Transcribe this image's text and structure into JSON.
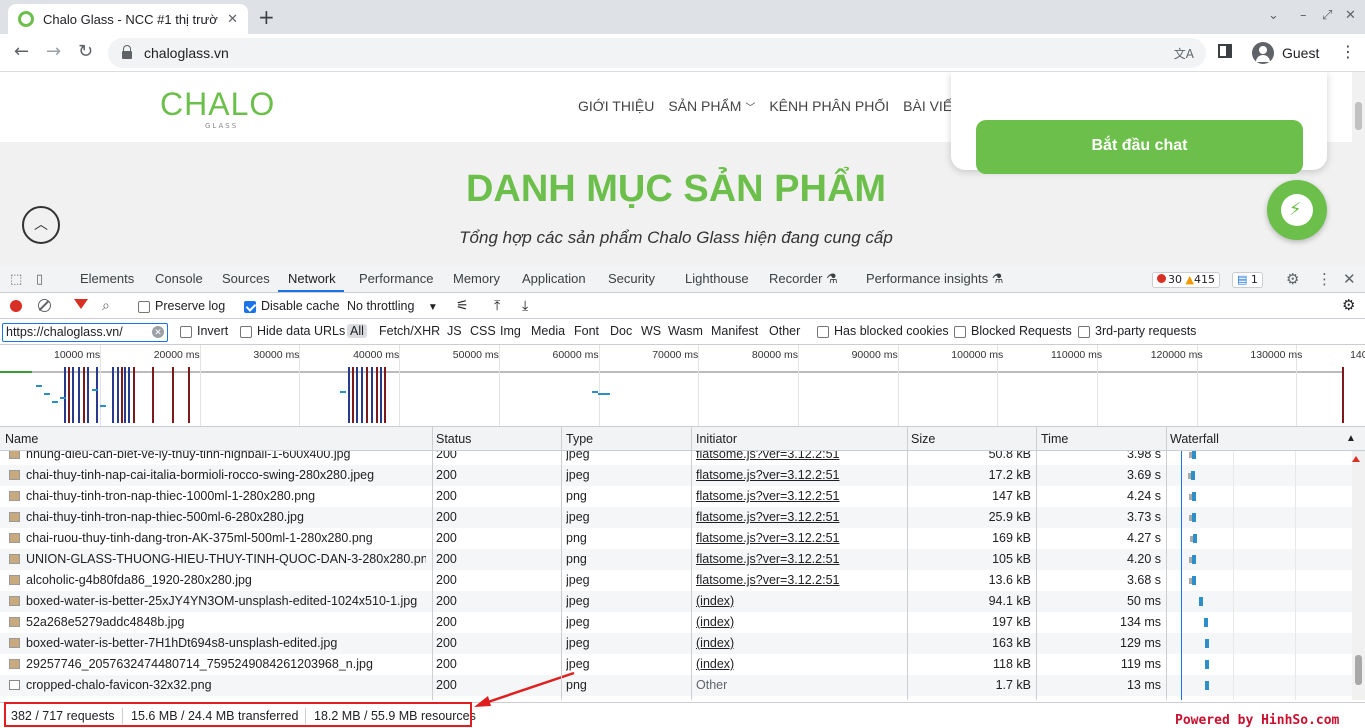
{
  "browser": {
    "tab_title": "Chalo Glass - NCC #1 thị trườ",
    "url": "chaloglass.vn",
    "profile": "Guest"
  },
  "site": {
    "logo": "CHALO",
    "logo_sub": "GLASS",
    "menu": [
      "GIỚI THIỆU",
      "SẢN PHẨM",
      "KÊNH PHÂN PHỐI",
      "BÀI VIẾ"
    ],
    "title": "DANH MỤC SẢN PHẨM",
    "subtitle": "Tổng hợp các sản phẩm Chalo Glass hiện đang cung cấp",
    "chat_button": "Bắt đầu chat",
    "brand_color": "#6dbf4b"
  },
  "devtools": {
    "tabs": [
      "Elements",
      "Console",
      "Sources",
      "Network",
      "Performance",
      "Memory",
      "Application",
      "Security",
      "Lighthouse",
      "Recorder",
      "Performance insights"
    ],
    "active_tab": "Network",
    "errors": "30",
    "warnings": "415",
    "messages": "1",
    "toolbar": {
      "preserve_log": "Preserve log",
      "disable_cache": "Disable cache",
      "throttling": "No throttling"
    },
    "filter": {
      "value": "https://chaloglass.vn/",
      "invert": "Invert",
      "hide_data_urls": "Hide data URLs",
      "types": [
        "All",
        "Fetch/XHR",
        "JS",
        "CSS",
        "Img",
        "Media",
        "Font",
        "Doc",
        "WS",
        "Wasm",
        "Manifest",
        "Other"
      ],
      "has_blocked_cookies": "Has blocked cookies",
      "blocked_requests": "Blocked Requests",
      "third_party": "3rd-party requests"
    },
    "overview_ticks": [
      "10000 ms",
      "20000 ms",
      "30000 ms",
      "40000 ms",
      "50000 ms",
      "60000 ms",
      "70000 ms",
      "80000 ms",
      "90000 ms",
      "100000 ms",
      "110000 ms",
      "120000 ms",
      "130000 ms",
      "140"
    ],
    "columns": [
      "Name",
      "Status",
      "Type",
      "Initiator",
      "Size",
      "Time",
      "Waterfall"
    ],
    "rows": [
      {
        "name": "nhung-dieu-can-biet-ve-ly-thuy-tinh-highball-1-600x400.jpg",
        "status": "200",
        "type": "jpeg",
        "initiator": "flatsome.js?ver=3.12.2:51",
        "size": "50.8 kB",
        "time": "3.98 s"
      },
      {
        "name": "chai-thuy-tinh-nap-cai-italia-bormioli-rocco-swing-280x280.jpeg",
        "status": "200",
        "type": "jpeg",
        "initiator": "flatsome.js?ver=3.12.2:51",
        "size": "17.2 kB",
        "time": "3.69 s"
      },
      {
        "name": "chai-thuy-tinh-tron-nap-thiec-1000ml-1-280x280.png",
        "status": "200",
        "type": "png",
        "initiator": "flatsome.js?ver=3.12.2:51",
        "size": "147 kB",
        "time": "4.24 s"
      },
      {
        "name": "chai-thuy-tinh-tron-nap-thiec-500ml-6-280x280.jpg",
        "status": "200",
        "type": "jpeg",
        "initiator": "flatsome.js?ver=3.12.2:51",
        "size": "25.9 kB",
        "time": "3.73 s"
      },
      {
        "name": "chai-ruou-thuy-tinh-dang-tron-AK-375ml-500ml-1-280x280.png",
        "status": "200",
        "type": "png",
        "initiator": "flatsome.js?ver=3.12.2:51",
        "size": "169 kB",
        "time": "4.27 s"
      },
      {
        "name": "UNION-GLASS-THUONG-HIEU-THUY-TINH-QUOC-DAN-3-280x280.png",
        "status": "200",
        "type": "png",
        "initiator": "flatsome.js?ver=3.12.2:51",
        "size": "105 kB",
        "time": "4.20 s"
      },
      {
        "name": "alcoholic-g4b80fda86_1920-280x280.jpg",
        "status": "200",
        "type": "jpeg",
        "initiator": "flatsome.js?ver=3.12.2:51",
        "size": "13.6 kB",
        "time": "3.68 s"
      },
      {
        "name": "boxed-water-is-better-25xJY4YN3OM-unsplash-edited-1024x510-1.jpg",
        "status": "200",
        "type": "jpeg",
        "initiator": "(index)",
        "size": "94.1 kB",
        "time": "50 ms"
      },
      {
        "name": "52a268e5279addc4848b.jpg",
        "status": "200",
        "type": "jpeg",
        "initiator": "(index)",
        "size": "197 kB",
        "time": "134 ms"
      },
      {
        "name": "boxed-water-is-better-7H1hDt694s8-unsplash-edited.jpg",
        "status": "200",
        "type": "jpeg",
        "initiator": "(index)",
        "size": "163 kB",
        "time": "129 ms"
      },
      {
        "name": "29257746_2057632474480714_7595249084261203968_n.jpg",
        "status": "200",
        "type": "jpeg",
        "initiator": "(index)",
        "size": "118 kB",
        "time": "119 ms"
      },
      {
        "name": "cropped-chalo-favicon-32x32.png",
        "status": "200",
        "type": "png",
        "initiator": "Other",
        "size": "1.7 kB",
        "time": "13 ms"
      }
    ],
    "summary": {
      "requests": "382 / 717 requests",
      "transferred": "15.6 MB / 24.4 MB transferred",
      "resources": "18.2 MB / 55.9 MB resources"
    }
  },
  "watermark": "Powered by HinhSo.com"
}
